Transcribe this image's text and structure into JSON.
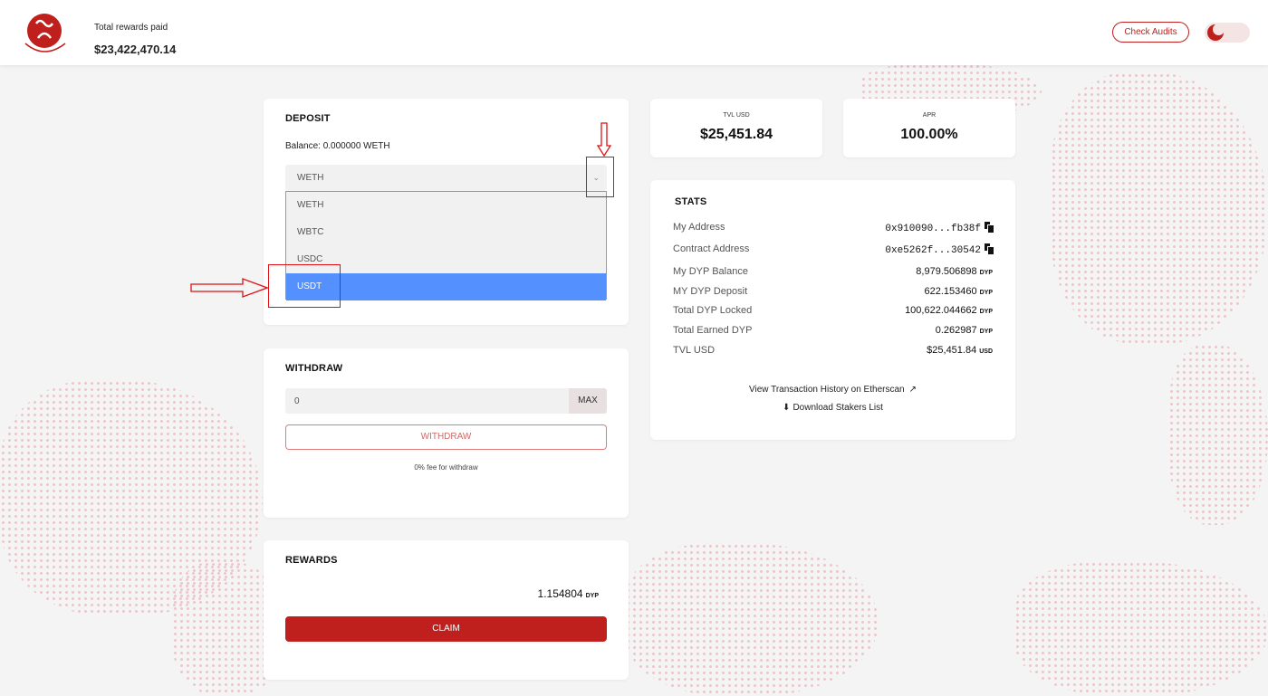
{
  "header": {
    "rewards_label": "Total rewards paid",
    "rewards_value": "$23,422,470.14",
    "audits_label": "Check Audits",
    "brand_color": "#c0201d"
  },
  "deposit": {
    "title": "DEPOSIT",
    "balance": "Balance: 0.000000 WETH",
    "selected_token": "WETH",
    "options": [
      "WETH",
      "WBTC",
      "USDC",
      "USDT"
    ],
    "highlighted_option": "USDT"
  },
  "withdraw": {
    "title": "WITHDRAW",
    "input_value": "0",
    "max_label": "MAX",
    "button_label": "WITHDRAW",
    "fee_note": "0% fee for withdraw"
  },
  "rewards": {
    "title": "REWARDS",
    "amount": "1.154804",
    "unit": "DYP",
    "claim_label": "CLAIM"
  },
  "metrics": {
    "tvl_label": "TVL USD",
    "tvl_value": "$25,451.84",
    "apr_label": "APR",
    "apr_value": "100.00%"
  },
  "stats": {
    "title": "STATS",
    "rows": [
      {
        "label": "My Address",
        "value": "0x910090...fb38f",
        "unit": ""
      },
      {
        "label": "Contract Address",
        "value": "0xe5262f...30542",
        "unit": ""
      },
      {
        "label": "My DYP Balance",
        "value": "8,979.506898",
        "unit": "DYP"
      },
      {
        "label": "MY DYP Deposit",
        "value": "622.153460",
        "unit": "DYP"
      },
      {
        "label": "Total DYP Locked",
        "value": "100,622.044662",
        "unit": "DYP"
      },
      {
        "label": "Total Earned DYP",
        "value": "0.262987",
        "unit": "DYP"
      },
      {
        "label": "TVL USD",
        "value": "$25,451.84",
        "unit": "USD"
      }
    ],
    "etherscan_link": "View Transaction History on Etherscan",
    "download_link": "Download Stakers List"
  }
}
